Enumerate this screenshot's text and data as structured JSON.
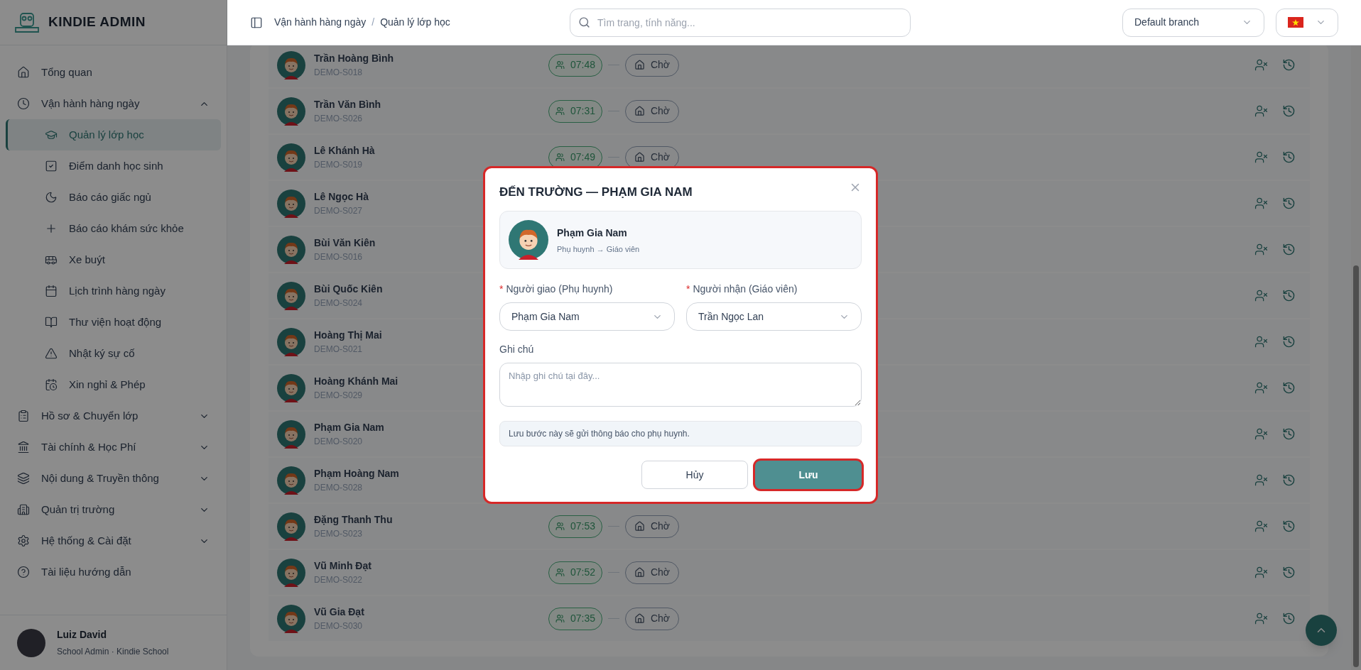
{
  "brand": {
    "name": "KINDIE ADMIN"
  },
  "sidebar": {
    "items": [
      {
        "kind": "link",
        "label": "Tổng quan",
        "selected": false
      },
      {
        "kind": "group",
        "label": "Vận hành hàng ngày",
        "expanded": true,
        "children": [
          {
            "label": "Quản lý lớp học",
            "selected": true
          },
          {
            "label": "Điểm danh học sinh",
            "selected": false
          },
          {
            "label": "Báo cáo giấc ngủ",
            "selected": false
          },
          {
            "label": "Báo cáo khám sức khỏe",
            "selected": false
          },
          {
            "label": "Xe buýt",
            "selected": false
          },
          {
            "label": "Lịch trình hàng ngày",
            "selected": false
          },
          {
            "label": "Thư viện hoạt động",
            "selected": false
          },
          {
            "label": "Nhật ký sự cố",
            "selected": false
          },
          {
            "label": "Xin nghỉ & Phép",
            "selected": false
          }
        ]
      },
      {
        "kind": "group",
        "label": "Hồ sơ & Chuyển lớp",
        "expanded": false
      },
      {
        "kind": "group",
        "label": "Tài chính & Học Phí",
        "expanded": false
      },
      {
        "kind": "group",
        "label": "Nội dung & Truyền thông",
        "expanded": false
      },
      {
        "kind": "group",
        "label": "Quản trị trường",
        "expanded": false
      },
      {
        "kind": "group",
        "label": "Hệ thống & Cài đặt",
        "expanded": false
      },
      {
        "kind": "link",
        "label": "Tài liệu hướng dẫn",
        "selected": false
      }
    ],
    "user": {
      "name": "Luiz David",
      "role": "School Admin · Kindie School"
    }
  },
  "header": {
    "breadcrumb": [
      "Vận hành hàng ngày",
      "Quản lý lớp học"
    ],
    "breadcrumb_separator": "/",
    "search": {
      "placeholder": "Tìm trang, tính năng..."
    },
    "branch": "Default branch"
  },
  "students": [
    {
      "name": "Trần Hoàng Bình",
      "code": "DEMO-S018",
      "arrival": "07:48",
      "status": "Chờ"
    },
    {
      "name": "Trần Văn Bình",
      "code": "DEMO-S026",
      "arrival": "07:31",
      "status": "Chờ"
    },
    {
      "name": "Lê Khánh Hà",
      "code": "DEMO-S019",
      "arrival": "07:49",
      "status": "Chờ"
    },
    {
      "name": "Lê Ngọc Hà",
      "code": "DEMO-S027"
    },
    {
      "name": "Bùi Văn Kiên",
      "code": "DEMO-S016"
    },
    {
      "name": "Bùi Quốc Kiên",
      "code": "DEMO-S024"
    },
    {
      "name": "Hoàng Thị Mai",
      "code": "DEMO-S021"
    },
    {
      "name": "Hoàng Khánh Mai",
      "code": "DEMO-S029"
    },
    {
      "name": "Phạm Gia Nam",
      "code": "DEMO-S020"
    },
    {
      "name": "Phạm Hoàng Nam",
      "code": "DEMO-S028"
    },
    {
      "name": "Đặng Thanh Thu",
      "code": "DEMO-S023",
      "arrival": "07:53",
      "status": "Chờ"
    },
    {
      "name": "Vũ Minh Đạt",
      "code": "DEMO-S022",
      "arrival": "07:52",
      "status": "Chờ"
    },
    {
      "name": "Vũ Gia Đạt",
      "code": "DEMO-S030",
      "arrival": "07:35",
      "status": "Chờ"
    }
  ],
  "dialog": {
    "title": "ĐẾN TRƯỜNG — PHẠM GIA NAM",
    "student": {
      "name": "Phạm Gia Nam",
      "subtitle": "Phụ huynh → Giáo viên"
    },
    "required_symbol": "*",
    "fields": [
      {
        "label": "Người giao (Phụ huynh)",
        "required": true,
        "value": "Phạm Gia Nam"
      },
      {
        "label": "Người nhận (Giáo viên)",
        "required": true,
        "value": "Trần Ngọc Lan"
      }
    ],
    "note": {
      "label": "Ghi chú",
      "placeholder": "Nhập ghi chú tại đây..."
    },
    "info": "Lưu bước này sẽ gửi thông báo cho phụ huynh.",
    "buttons": [
      {
        "kind": "secondary",
        "label": "Hủy"
      },
      {
        "kind": "primary",
        "label": "Lưu"
      }
    ]
  }
}
